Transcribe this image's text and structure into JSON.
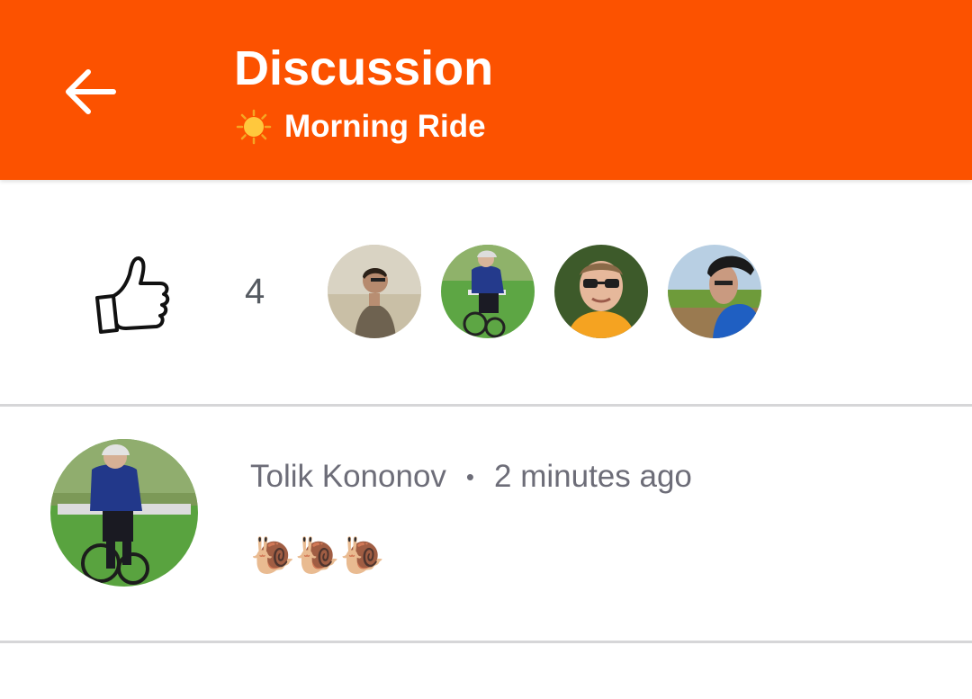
{
  "header": {
    "title": "Discussion",
    "activity_icon": "sun-icon",
    "activity_name": "Morning Ride",
    "back_icon": "arrow-left-icon",
    "background_color": "#fc5200"
  },
  "kudos": {
    "icon": "thumbs-up-icon",
    "count": "4",
    "avatars": [
      {
        "icon": "avatar-man-standing"
      },
      {
        "icon": "avatar-cyclist-blue"
      },
      {
        "icon": "avatar-man-sunglasses"
      },
      {
        "icon": "avatar-cyclist-helmet"
      }
    ]
  },
  "comments": [
    {
      "author": "Tolik Kononov",
      "separator": "•",
      "time": "2 minutes ago",
      "text": "🐌🐌🐌"
    }
  ]
}
